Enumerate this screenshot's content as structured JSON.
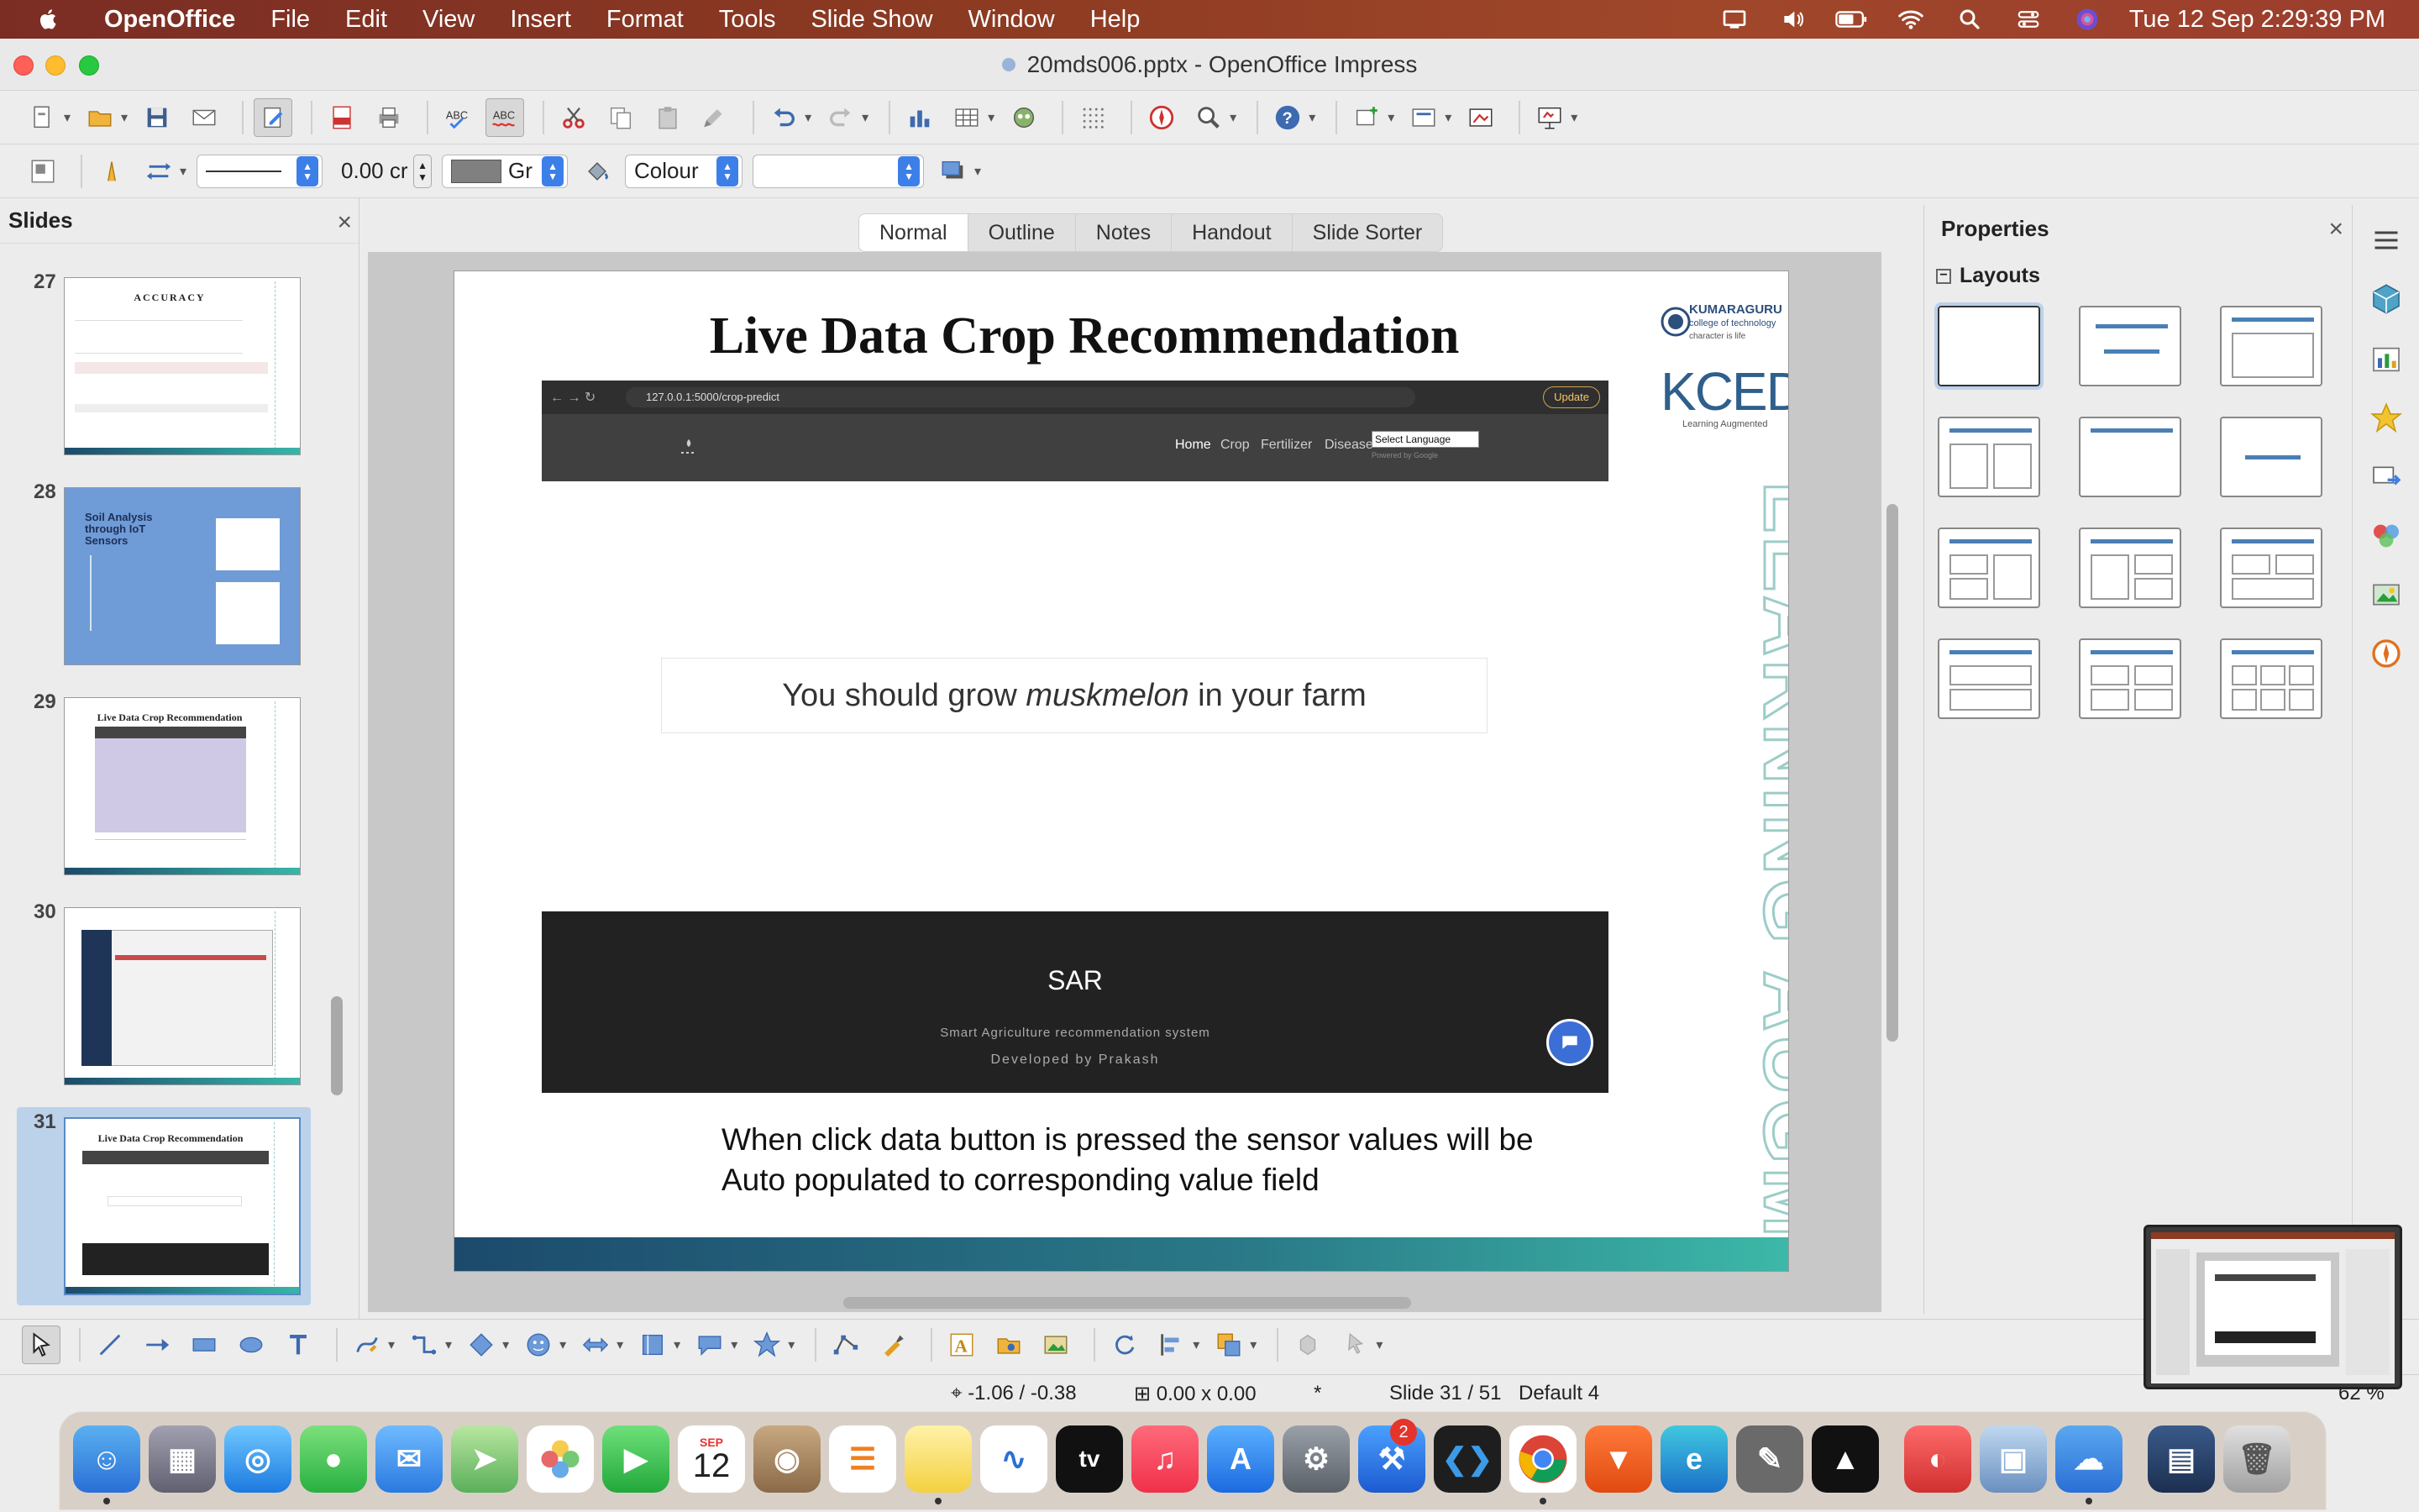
{
  "menubar": {
    "app_name": "OpenOffice",
    "items": [
      "File",
      "Edit",
      "View",
      "Insert",
      "Format",
      "Tools",
      "Slide Show",
      "Window",
      "Help"
    ],
    "clock": "Tue 12 Sep  2:29:39 PM",
    "status_icons": [
      "screen-share-icon",
      "volume-icon",
      "battery-icon",
      "wifi-icon",
      "spotlight-icon",
      "control-center-icon",
      "siri-icon"
    ]
  },
  "window": {
    "title": "20mds006.pptx - OpenOffice Impress"
  },
  "toolbar2": {
    "line_width": "0.00 cr",
    "color_name": "Gr",
    "area_style": "Colour",
    "area_fill": ""
  },
  "slides_panel": {
    "title": "Slides",
    "thumbnails": [
      {
        "number": "27",
        "title": "ACCURACY"
      },
      {
        "number": "28",
        "title": "Soil Analysis through IoT Sensors"
      },
      {
        "number": "29",
        "title": "Live Data Crop Recommendation"
      },
      {
        "number": "30",
        "title": ""
      },
      {
        "number": "31",
        "title": "Live Data Crop Recommendation"
      }
    ]
  },
  "view_tabs": [
    "Normal",
    "Outline",
    "Notes",
    "Handout",
    "Slide Sorter"
  ],
  "slide": {
    "title": "Live Data Crop Recommendation",
    "logo_name": "KUMARAGURU",
    "logo_name2": "college of technology",
    "logo_sub": "character is life",
    "kced": "KCED",
    "kced_tag": "Learning Augmented",
    "vertical_text": "LEARNING AUGMENTED",
    "browser": {
      "url": "127.0.0.1:5000/crop-predict",
      "update_label": "Update"
    },
    "web_nav": {
      "items": [
        "Home",
        "Crop",
        "Fertilizer",
        "Disease"
      ],
      "language_select": "Select Language",
      "powered_by": "Powered by Google"
    },
    "result_prefix": "You should grow ",
    "result_crop": "muskmelon",
    "result_suffix": " in your farm",
    "footer": {
      "title": "SAR",
      "subtitle": "Smart Agriculture recommendation system",
      "developer": "Developed by Prakash"
    },
    "caption_line1": "When click data button is pressed the sensor values will be",
    "caption_line2": "Auto populated to corresponding value field"
  },
  "properties_panel": {
    "title": "Properties",
    "section": "Layouts"
  },
  "statusbar": {
    "position": "-1.06 / -0.38",
    "size": "0.00 x 0.00",
    "modified": "*",
    "slide_info": "Slide 31 / 51",
    "master": "Default 4",
    "zoom": "62 %"
  },
  "dock": {
    "calendar_month": "SEP",
    "calendar_day": "12",
    "settings_badge": "2"
  }
}
